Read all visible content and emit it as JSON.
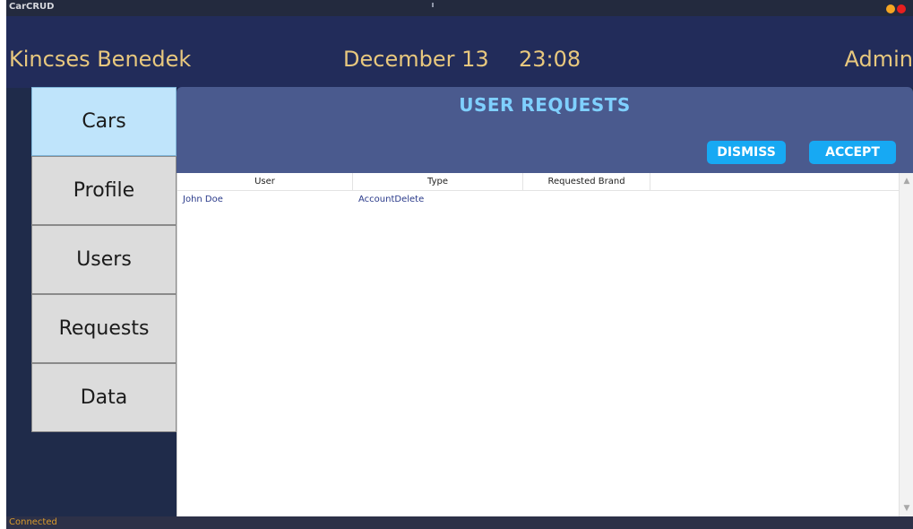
{
  "window": {
    "app_title": "CarCRUD",
    "min_color": "#f5a623",
    "close_color": "#e81f1f"
  },
  "header": {
    "user_name": "Kincses Benedek",
    "date": "December 13",
    "time": "23:08",
    "role": "Admin"
  },
  "nav": {
    "items": [
      {
        "label": "Cars",
        "active": true
      },
      {
        "label": "Profile",
        "active": false
      },
      {
        "label": "Users",
        "active": false
      },
      {
        "label": "Requests",
        "active": false
      },
      {
        "label": "Data",
        "active": false
      }
    ]
  },
  "panel": {
    "title": "USER REQUESTS",
    "dismiss_label": "DISMISS",
    "accept_label": "ACCEPT"
  },
  "table": {
    "columns": [
      "User",
      "Type",
      "Requested Brand"
    ],
    "rows": [
      {
        "user": "John Doe",
        "type": "AccountDelete",
        "brand": ""
      }
    ]
  },
  "status": {
    "text": "Connected"
  }
}
